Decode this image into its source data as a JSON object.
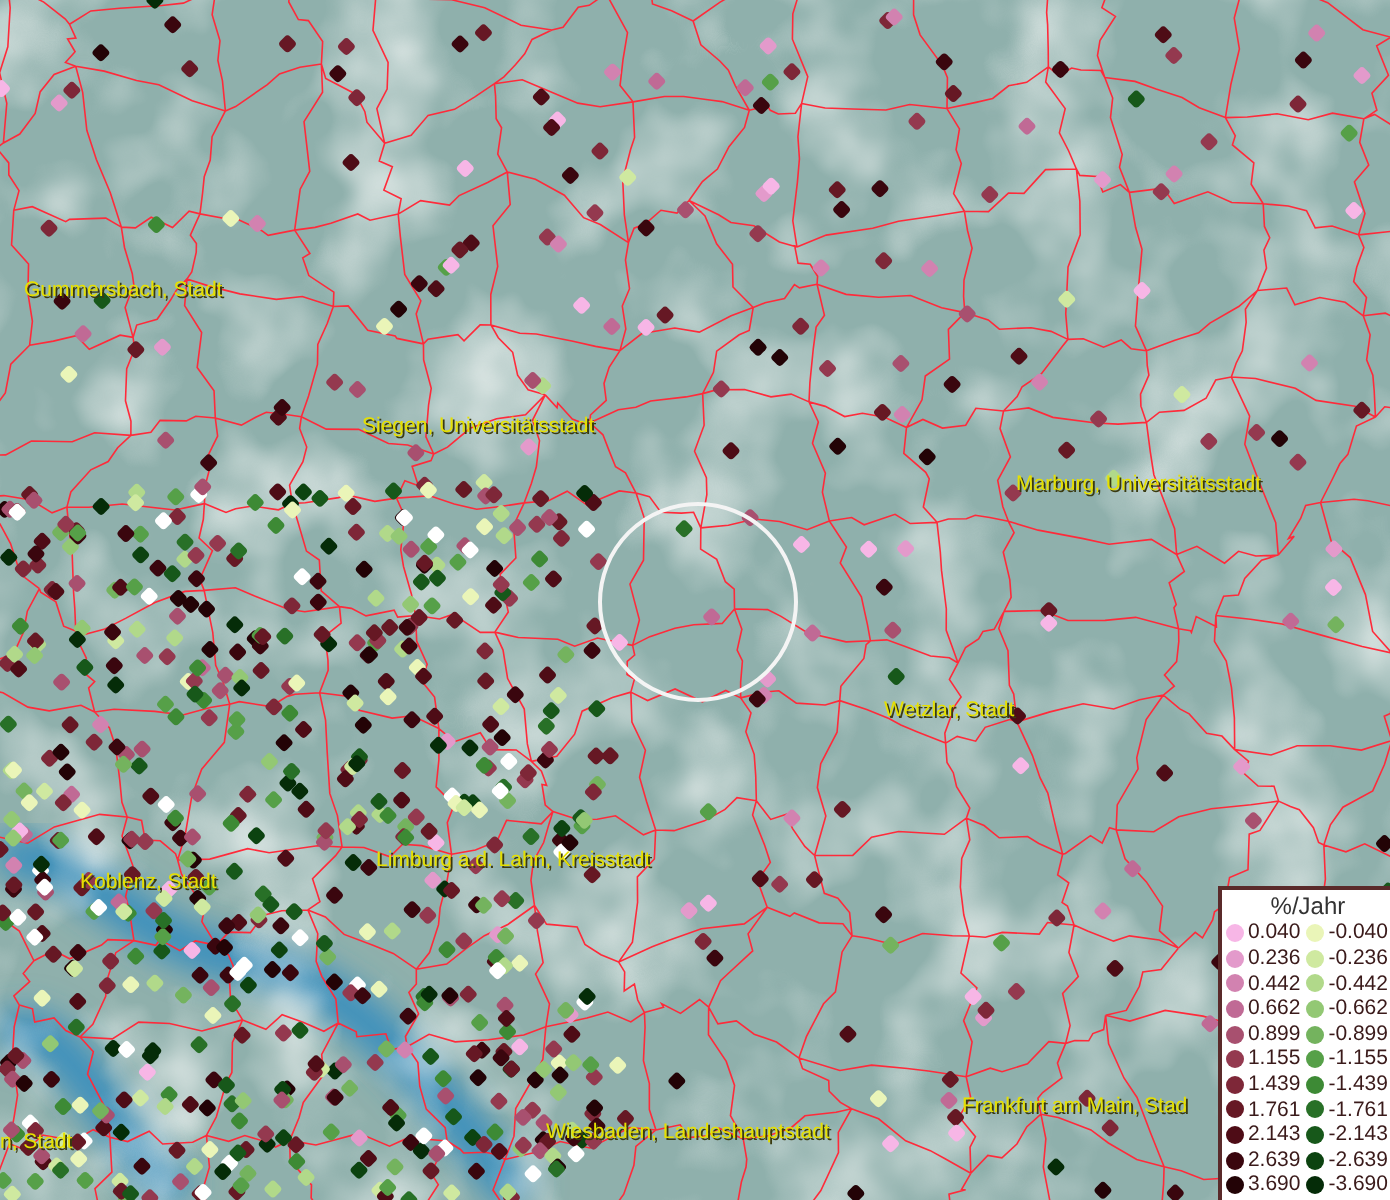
{
  "map": {
    "places": [
      {
        "name": "Gummersbach, Stadt"
      },
      {
        "name": "Siegen, Universitätsstadt"
      },
      {
        "name": "Marburg, Universitätsstadt"
      },
      {
        "name": "Wetzlar, Stadt"
      },
      {
        "name": "Koblenz, Stadt"
      },
      {
        "name": "Limburg a.d. Lahn, Kreisstadt"
      },
      {
        "name": "Wiesbaden, Landeshauptstadt"
      },
      {
        "name": "Frankfurt am Main, Stad"
      },
      {
        "name": "n, Stadt"
      }
    ]
  },
  "legend": {
    "title": "%/Jahr",
    "positive": [
      {
        "label": "0.040",
        "color": "#f7b6e6"
      },
      {
        "label": "0.236",
        "color": "#e39acb"
      },
      {
        "label": "0.442",
        "color": "#d282b0"
      },
      {
        "label": "0.662",
        "color": "#c06a95"
      },
      {
        "label": "0.899",
        "color": "#a8506f"
      },
      {
        "label": "1.155",
        "color": "#94394f"
      },
      {
        "label": "1.439",
        "color": "#7e2738"
      },
      {
        "label": "1.761",
        "color": "#661824"
      },
      {
        "label": "2.143",
        "color": "#4e0c16"
      },
      {
        "label": "2.639",
        "color": "#3a060e"
      },
      {
        "label": "3.690",
        "color": "#230306"
      }
    ],
    "negative": [
      {
        "label": "-0.040",
        "color": "#eaf5b8"
      },
      {
        "label": "-0.236",
        "color": "#cfe9a0"
      },
      {
        "label": "-0.442",
        "color": "#b1d98a"
      },
      {
        "label": "-0.662",
        "color": "#93c874"
      },
      {
        "label": "-0.899",
        "color": "#74b35e"
      },
      {
        "label": "-1.155",
        "color": "#56a048"
      },
      {
        "label": "-1.439",
        "color": "#3d8a35"
      },
      {
        "label": "-1.761",
        "color": "#287027"
      },
      {
        "label": "-2.143",
        "color": "#17581a"
      },
      {
        "label": "-2.639",
        "color": "#0c4310"
      },
      {
        "label": "-3.690",
        "color": "#052c08"
      }
    ]
  }
}
